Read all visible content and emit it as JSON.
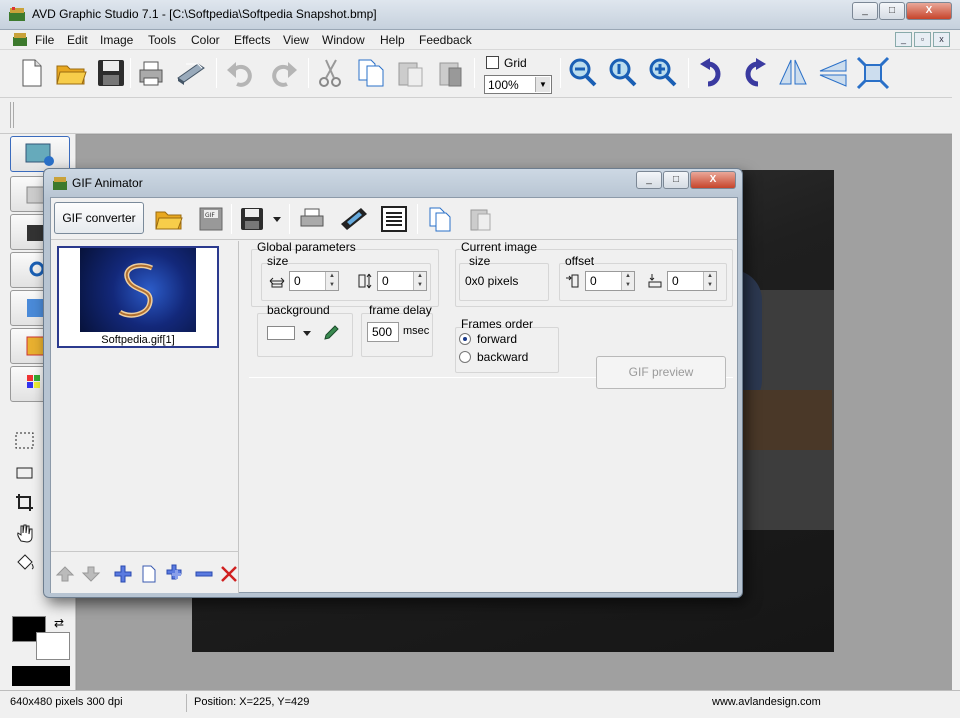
{
  "window": {
    "title": "AVD Graphic Studio 7.1 - [C:\\Softpedia\\Softpedia Snapshot.bmp]",
    "minimize": "_",
    "maximize": "□",
    "close": "X"
  },
  "menu": [
    "File",
    "Edit",
    "Image",
    "Tools",
    "Color",
    "Effects",
    "View",
    "Window",
    "Help",
    "Feedback"
  ],
  "mdi_buttons": [
    "_",
    "▫",
    "x"
  ],
  "toolbar": {
    "grid_label": "Grid",
    "zoom_value": "100%",
    "zoom_arrow": "▼",
    "icons": [
      "new-icon",
      "open-folder-icon",
      "save-icon",
      "print-icon",
      "scan-icon",
      "undo-icon",
      "redo-icon",
      "cut-icon",
      "copy-icon",
      "paste-icon",
      "paste-special-icon",
      "zoom-out-icon",
      "zoom-actual-icon",
      "zoom-in-icon",
      "rotate-left-icon",
      "rotate-right-icon",
      "flip-horizontal-icon",
      "flip-vertical-icon",
      "fit-screen-icon"
    ]
  },
  "colors": {
    "foreground": "#000000",
    "background": "#ffffff",
    "accent": "#3a6bbd",
    "selection_border": "#2b3a8e"
  },
  "gif_animator": {
    "title": "GIF Animator",
    "converter_button": "GIF converter",
    "frame": {
      "label": "Softpedia.gif[1]"
    },
    "global_parameters": {
      "title": "Global parameters",
      "size_label": "size",
      "width": "0",
      "height": "0",
      "background_label": "background",
      "frame_delay_label": "frame delay",
      "frame_delay": "500",
      "frame_delay_unit": "msec"
    },
    "current_image": {
      "title": "Current image",
      "size_label": "size",
      "size_value": "0x0 pixels",
      "offset_label": "offset",
      "offset_x": "0",
      "offset_y": "0"
    },
    "frames_order": {
      "title": "Frames order",
      "options": [
        {
          "label": "forward",
          "selected": true
        },
        {
          "label": "backward",
          "selected": false
        }
      ]
    },
    "preview_button": "GIF preview"
  },
  "status": {
    "image_info": "640x480 pixels  300 dpi",
    "position": "Position: X=225, Y=429",
    "website": "www.avlandesign.com"
  }
}
